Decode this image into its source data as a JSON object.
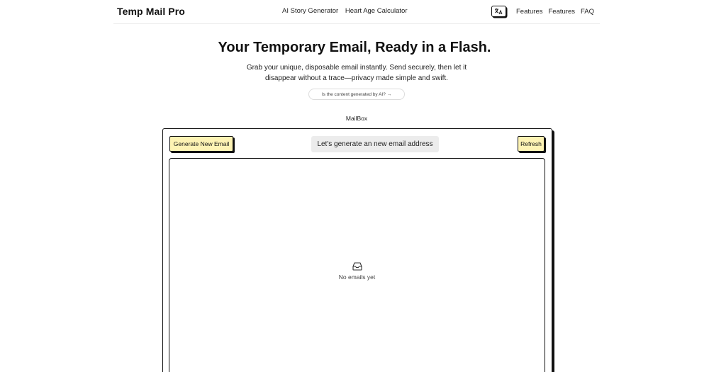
{
  "header": {
    "brand": "Temp Mail Pro",
    "nav_center": [
      "AI Story Generator",
      "Heart Age Calculator"
    ],
    "nav_right": [
      "Features",
      "Features",
      "FAQ"
    ],
    "lang_icon": "translate-icon"
  },
  "hero": {
    "title": "Your Temporary Email, Ready in a Flash.",
    "subtitle": "Grab your unique, disposable email instantly. Send securely, then let it disappear without a trace—privacy made simple and swift.",
    "ai_pill": "Is the content generated by AI? →"
  },
  "mailbox": {
    "label": "MailBox",
    "generate_label": "Generate New Email",
    "address_text": "Let's generate an new email address",
    "refresh_label": "Refresh",
    "empty_icon": "inbox-icon",
    "empty_text": "No emails yet"
  },
  "colors": {
    "button_yellow": "#fdf3b4",
    "address_bg": "#ececec",
    "border": "#111111"
  }
}
